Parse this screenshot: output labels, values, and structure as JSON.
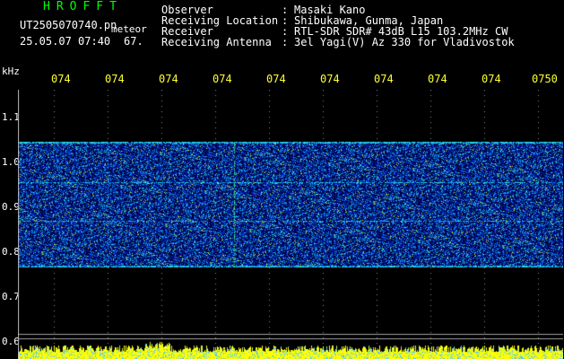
{
  "header": {
    "app_title": "HROFFT",
    "file_name": "UT2505070740.pn",
    "meteor_tag": "meteor",
    "date_time": "25.05.07 07:40",
    "count": "67."
  },
  "info": [
    {
      "label": "Observer",
      "value": "Masaki Kano"
    },
    {
      "label": "Receiving Location",
      "value": "Shibukawa, Gunma, Japan"
    },
    {
      "label": "Receiver",
      "value": "RTL-SDR SDR# 43dB L15 103.2MHz CW"
    },
    {
      "label": "Receiving Antenna",
      "value": "3el Yagi(V) Az 330 for Vladivostok"
    }
  ],
  "axis": {
    "y_unit": "kHz",
    "x_ticks": [
      "074",
      "074",
      "074",
      "074",
      "074",
      "074",
      "074",
      "074",
      "074",
      "0750"
    ],
    "y_ticks": [
      "1.1",
      "1.0",
      "0.9",
      "0.8",
      "0.7",
      "0.6"
    ]
  },
  "colors": {
    "title": "#00ff00",
    "x_tick": "#ffff33",
    "text": "#ffffff",
    "noise_band": "#1030c0",
    "baseline_noise": "#ffff00"
  }
}
